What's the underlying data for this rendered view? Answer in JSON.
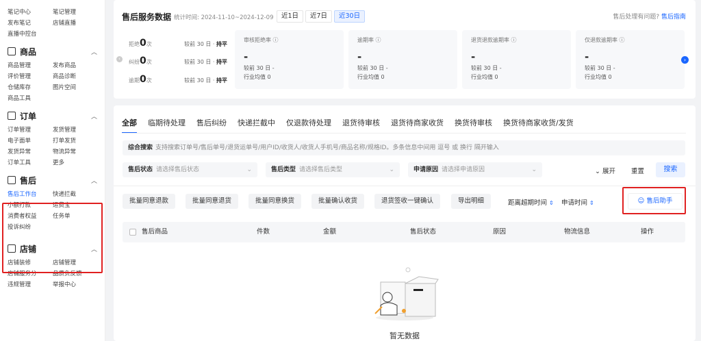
{
  "sidebar": {
    "top_items": [
      "笔记中心",
      "笔记管理",
      "发布笔记",
      "店铺直播",
      "直播中控台"
    ],
    "sections": [
      {
        "title": "商品",
        "items": [
          "商品管理",
          "发布商品",
          "评价管理",
          "商品诊断",
          "仓储库存",
          "图片空间",
          "商品工具"
        ]
      },
      {
        "title": "订单",
        "items": [
          "订单管理",
          "发货管理",
          "电子面单",
          "打单发货",
          "发货异常",
          "物流异常",
          "订单工具",
          "更多"
        ]
      },
      {
        "title": "售后",
        "items": [
          "售后工作台",
          "快递拦截",
          "小额打款",
          "运费宝",
          "消费者权益",
          "任务单",
          "投诉纠纷"
        ]
      },
      {
        "title": "店铺",
        "items": [
          "店铺装修",
          "店铺管理",
          "店铺服务分",
          "品质负反馈",
          "违规管理",
          "举报中心"
        ]
      }
    ],
    "active_item": "售后工作台"
  },
  "service": {
    "title": "售后服务数据",
    "time": "统计时间: 2024-11-10~2024-12-09",
    "ranges": [
      "近1日",
      "近7日",
      "近30日"
    ],
    "selected_range": "近30日",
    "help_text": "售后处理有问题?",
    "help_link": "售后指南",
    "rates": [
      {
        "label": "拒绝",
        "value": "0",
        "unit": "次",
        "cmp": "较前 30 日 · ",
        "trend": "持平"
      },
      {
        "label": "纠纷",
        "value": "0",
        "unit": "次",
        "cmp": "较前 30 日 · ",
        "trend": "持平"
      },
      {
        "label": "逾期",
        "value": "0",
        "unit": "次",
        "cmp": "较前 30 日 · ",
        "trend": "持平"
      }
    ],
    "metrics": [
      {
        "title": "审核拒绝率 ⓘ",
        "value": "-",
        "cmp": "较前 30 日 -",
        "industry": "行业均值 0"
      },
      {
        "title": "逾期率 ⓘ",
        "value": "-",
        "cmp": "较前 30 日 -",
        "industry": "行业均值 0"
      },
      {
        "title": "退货退款逾期率 ⓘ",
        "value": "-",
        "cmp": "较前 30 日 -",
        "industry": "行业均值 0"
      },
      {
        "title": "仅退款逾期率 ⓘ",
        "value": "-",
        "cmp": "较前 30 日 -",
        "industry": "行业均值 0"
      }
    ]
  },
  "tabs": [
    "全部",
    "临期待处理",
    "售后纠纷",
    "快递拦截中",
    "仅退款待处理",
    "退货待审核",
    "退货待商家收货",
    "换货待审核",
    "换货待商家收货/发货"
  ],
  "search": {
    "label": "综合搜索",
    "placeholder": "支持搜索订单号/售后单号/退货运单号/用户ID/收货人/收货人手机号/商品名称/规格ID。多条信息中间用 逗号 或 换行 隔开输入"
  },
  "filters": [
    {
      "label": "售后状态",
      "placeholder": "请选择售后状态"
    },
    {
      "label": "售后类型",
      "placeholder": "请选择售后类型"
    },
    {
      "label": "申请原因",
      "placeholder": "请选择申请原因"
    }
  ],
  "expand": "展开",
  "reset": "重置",
  "search_btn": "搜索",
  "batch": [
    "批量同意退款",
    "批量同意退货",
    "批量同意换货",
    "批量确认收货",
    "退货签收一键确认",
    "导出明细"
  ],
  "sorts": [
    "距离超期时间",
    "申请时间"
  ],
  "assistant": "售后助手",
  "columns": [
    "售后商品",
    "件数",
    "金额",
    "售后状态",
    "原因",
    "物流信息",
    "操作"
  ],
  "empty": "暂无数据",
  "colors": {
    "accent": "#1a66ff",
    "highlight": "#e02020"
  }
}
